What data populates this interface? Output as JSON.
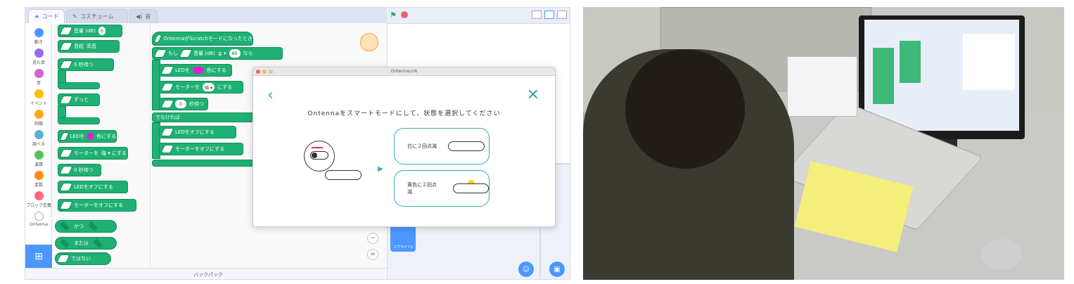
{
  "scratch": {
    "tabs": [
      "コード",
      "コスチューム",
      "音"
    ],
    "categories": [
      {
        "label": "動き",
        "color": "#4c97ff"
      },
      {
        "label": "見た目",
        "color": "#9966ff"
      },
      {
        "label": "音",
        "color": "#cf63cf"
      },
      {
        "label": "イベント",
        "color": "#ffbf00"
      },
      {
        "label": "制御",
        "color": "#ffab19"
      },
      {
        "label": "調べる",
        "color": "#5cb1d6"
      },
      {
        "label": "演算",
        "color": "#59c059"
      },
      {
        "label": "変数",
        "color": "#ff8c1a"
      },
      {
        "label": "ブロック定義",
        "color": "#ff6680"
      },
      {
        "label": "Ontenna",
        "color": "#ffffff"
      }
    ],
    "palette_blocks": [
      {
        "label": "音量 (dB)",
        "extra": "< 0"
      },
      {
        "label": "音程",
        "extra": "高音"
      },
      {
        "label": "0 秒待つ",
        "extra": ""
      },
      {
        "label": "ずっと",
        "extra": ""
      },
      {
        "label": "LEDを",
        "extra": "色にする"
      },
      {
        "label": "モーターを",
        "extra": "強 ▾ にする"
      },
      {
        "label": "0 秒待つ",
        "extra": ""
      },
      {
        "label": "LEDをオフにする",
        "extra": ""
      },
      {
        "label": "モーターをオフにする",
        "extra": ""
      },
      {
        "label": "かつ",
        "extra": ""
      },
      {
        "label": "または",
        "extra": ""
      },
      {
        "label": "ではない",
        "extra": ""
      }
    ],
    "script_blocks": {
      "hat": "OntennaがScratchモードになったとき",
      "if": "もし",
      "if_cond": "音量 (dB)",
      "if_op": "≧ ▾",
      "if_value": "60",
      "if_then": "なら",
      "led": "LEDを",
      "led_end": "色にする",
      "motor": "モーターを",
      "motor_val": "強 ▾",
      "motor_end": "にする",
      "wait_val": "0",
      "wait": "秒待つ",
      "else": "でなければ",
      "led_off": "LEDをオフにする",
      "motor_off": "モーターをオフにする"
    },
    "backpack_label": "バックパック",
    "sprite_label": "スプライト1",
    "zoom_in": "+",
    "zoom_out": "−",
    "zoom_reset": "="
  },
  "dialog": {
    "title": "OntennaLink",
    "back": "‹",
    "close": "✕",
    "instruction": "Ontennaをスマートモードにして、状態を選択してください",
    "option1": "白に２回点滅",
    "option2": "黄色に２回点滅"
  },
  "colors": {
    "block_green": "#1fb074",
    "accent_teal": "#3aa8b5",
    "scratch_blue": "#4c97ff"
  }
}
